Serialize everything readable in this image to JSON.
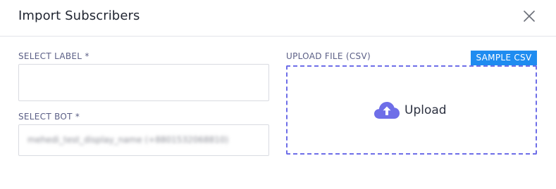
{
  "dialog": {
    "title": "Import Subscribers",
    "close_icon": "close-icon"
  },
  "form": {
    "label_field": {
      "label": "SELECT LABEL *",
      "value": ""
    },
    "bot_field": {
      "label": "SELECT BOT *",
      "value": "mehedi_test_display_name (+8801532068810)"
    },
    "upload": {
      "label": "UPLOAD FILE (CSV)",
      "sample_button": "SAMPLE CSV",
      "dropzone_text": "Upload",
      "icon": "cloud-upload-icon"
    }
  },
  "colors": {
    "accent_blue": "#1f8cf0",
    "dropzone_border": "#6e6ee8",
    "upload_icon": "#6e6ee8",
    "label_text": "#5b5f86"
  }
}
